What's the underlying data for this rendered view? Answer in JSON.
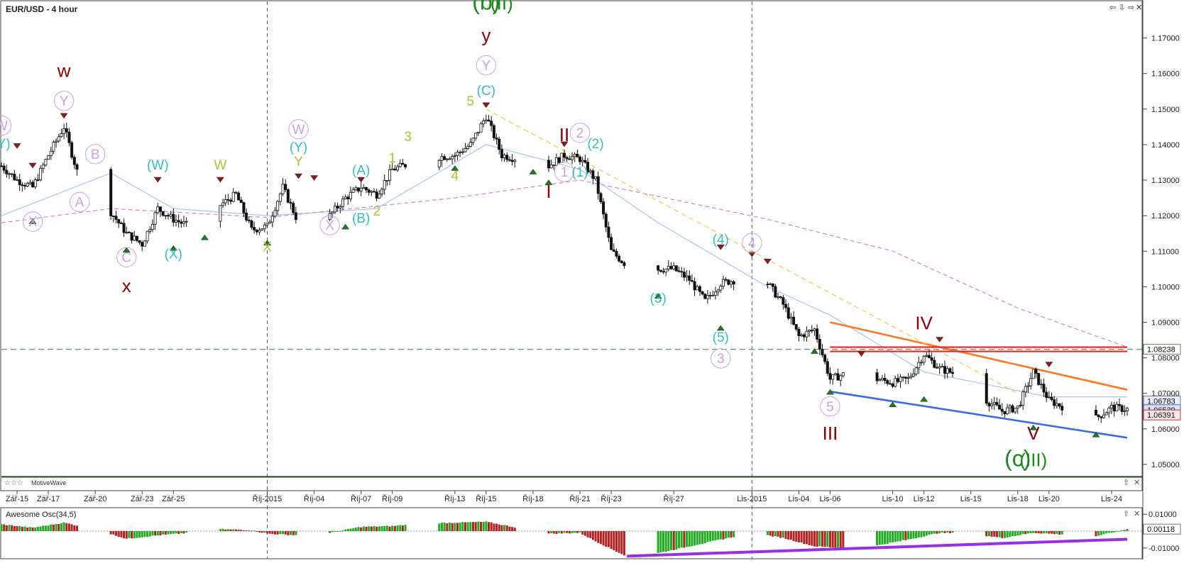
{
  "window": {
    "title": "EUR/USD - 4 hour",
    "controls": [
      "⇦",
      "⇩",
      "⇨",
      "✕"
    ]
  },
  "price_panel": {
    "y_ticks": [
      "1.17000",
      "1.16000",
      "1.15000",
      "1.14000",
      "1.13000",
      "1.12000",
      "1.11000",
      "1.10000",
      "1.09000",
      "1.08000",
      "1.07000",
      "1.06000",
      "1.05000"
    ],
    "price_badges": [
      {
        "text": "1.08238",
        "value": 1.08238
      },
      {
        "text": "1.06783",
        "value": 1.06783
      },
      {
        "text": "1.06539",
        "value": 1.06539
      },
      {
        "text": "1.06391",
        "value": 1.06391
      }
    ],
    "plugin_label": "MotiveWave",
    "x_ticks": [
      "Zář-15",
      "Zář-17",
      "Zář-20",
      "Zář-23",
      "Zář-25",
      "Říj-2015",
      "Říj-04",
      "Říj-07",
      "Říj-09",
      "Říj-13",
      "Říj-15",
      "Říj-18",
      "Říj-21",
      "Říj-23",
      "Říj-27",
      "Lis-2015",
      "Lis-04",
      "Lis-06",
      "Lis-10",
      "Lis-12",
      "Lis-15",
      "Lis-18",
      "Lis-20",
      "Lis-24"
    ]
  },
  "osc_panel": {
    "title": "Awesome Osc(34,5)",
    "y_ticks": [
      "0.01000",
      "-0.01000"
    ],
    "last_value": "0.00118",
    "controls": [
      "⇧",
      "✕"
    ]
  },
  "chart_data": [
    {
      "type": "candlestick",
      "title": "EUR/USD - 4 hour",
      "ylim": [
        1.043,
        1.1795
      ],
      "x_start": "2015-09-14",
      "x_end": "2015-11-25",
      "close_path": [
        [
          "2015-09-14",
          1.134
        ],
        [
          "2015-09-15",
          1.13
        ],
        [
          "2015-09-16",
          1.128
        ],
        [
          "2015-09-17",
          1.137
        ],
        [
          "2015-09-18",
          1.145
        ],
        [
          "2015-09-19",
          1.13
        ],
        [
          "2015-09-21",
          1.121
        ],
        [
          "2015-09-22",
          1.115
        ],
        [
          "2015-09-23",
          1.112
        ],
        [
          "2015-09-24",
          1.122
        ],
        [
          "2015-09-25",
          1.119
        ],
        [
          "2015-09-26",
          1.117
        ],
        [
          "2015-09-28",
          1.123
        ],
        [
          "2015-09-29",
          1.126
        ],
        [
          "2015-09-30",
          1.116
        ],
        [
          "2015-10-01",
          1.117
        ],
        [
          "2015-10-02",
          1.128
        ],
        [
          "2015-10-03",
          1.118
        ],
        [
          "2015-10-05",
          1.12
        ],
        [
          "2015-10-06",
          1.125
        ],
        [
          "2015-10-07",
          1.128
        ],
        [
          "2015-10-08",
          1.126
        ],
        [
          "2015-10-09",
          1.133
        ],
        [
          "2015-10-11",
          1.136
        ],
        [
          "2015-10-13",
          1.137
        ],
        [
          "2015-10-14",
          1.14
        ],
        [
          "2015-10-15",
          1.148
        ],
        [
          "2015-10-16",
          1.137
        ],
        [
          "2015-10-18",
          1.135
        ],
        [
          "2015-10-19",
          1.134
        ],
        [
          "2015-10-20",
          1.137
        ],
        [
          "2015-10-21",
          1.136
        ],
        [
          "2015-10-22",
          1.13
        ],
        [
          "2015-10-23",
          1.11
        ],
        [
          "2015-10-25",
          1.102
        ],
        [
          "2015-10-26",
          1.105
        ],
        [
          "2015-10-27",
          1.105
        ],
        [
          "2015-10-28",
          1.102
        ],
        [
          "2015-10-29",
          1.096
        ],
        [
          "2015-10-30",
          1.101
        ],
        [
          "2015-11-01",
          1.103
        ],
        [
          "2015-11-02",
          1.101
        ],
        [
          "2015-11-03",
          1.095
        ],
        [
          "2015-11-04",
          1.086
        ],
        [
          "2015-11-05",
          1.088
        ],
        [
          "2015-11-06",
          1.074
        ],
        [
          "2015-11-08",
          1.077
        ],
        [
          "2015-11-09",
          1.074
        ],
        [
          "2015-11-10",
          1.073
        ],
        [
          "2015-11-11",
          1.074
        ],
        [
          "2015-11-12",
          1.081
        ],
        [
          "2015-11-13",
          1.077
        ],
        [
          "2015-11-15",
          1.074
        ],
        [
          "2015-11-16",
          1.068
        ],
        [
          "2015-11-17",
          1.065
        ],
        [
          "2015-11-18",
          1.066
        ],
        [
          "2015-11-19",
          1.076
        ],
        [
          "2015-11-20",
          1.068
        ],
        [
          "2015-11-22",
          1.064
        ],
        [
          "2015-11-23",
          1.063
        ],
        [
          "2015-11-24",
          1.066
        ],
        [
          "2015-11-25",
          1.0655
        ]
      ],
      "horizontal_lines": [
        {
          "value": 1.08238,
          "style": "dashed",
          "color": "#5a8a5a"
        },
        {
          "value": 1.083,
          "from": "2015-11-06",
          "to": "2015-11-25",
          "color": "#ee2222"
        },
        {
          "value": 1.0818,
          "from": "2015-11-06",
          "to": "2015-11-25",
          "color": "#ee2222"
        },
        {
          "value": 1.0465,
          "style": "solid",
          "color": "#1d4f1d"
        }
      ],
      "trend_lines": [
        {
          "from": [
            "2015-11-06",
            1.09
          ],
          "to": [
            "2015-11-25",
            1.071
          ],
          "color": "#ff7722"
        },
        {
          "from": [
            "2015-11-06",
            1.0705
          ],
          "to": [
            "2015-11-25",
            1.0575
          ],
          "color": "#3a6ae8"
        },
        {
          "from": [
            "2015-10-15",
            1.15
          ],
          "to": [
            "2015-11-18",
            1.07
          ],
          "color": "#f2c84a",
          "style": "dashed"
        }
      ],
      "moving_averages": [
        {
          "color": "#aac4ee",
          "points": [
            [
              "2015-09-14",
              1.12
            ],
            [
              "2015-09-21",
              1.132
            ],
            [
              "2015-09-25",
              1.122
            ],
            [
              "2015-10-01",
              1.12
            ],
            [
              "2015-10-08",
              1.122
            ],
            [
              "2015-10-15",
              1.14
            ],
            [
              "2015-10-21",
              1.133
            ],
            [
              "2015-10-26",
              1.118
            ],
            [
              "2015-11-02",
              1.1
            ],
            [
              "2015-11-06",
              1.092
            ],
            [
              "2015-11-12",
              1.076
            ],
            [
              "2015-11-20",
              1.069
            ],
            [
              "2015-11-25",
              1.069
            ]
          ]
        },
        {
          "color": "#cc88cc",
          "style": "dashed",
          "points": [
            [
              "2015-09-14",
              1.118
            ],
            [
              "2015-09-21",
              1.122
            ],
            [
              "2015-10-01",
              1.1195
            ],
            [
              "2015-10-13",
              1.125
            ],
            [
              "2015-10-21",
              1.13
            ],
            [
              "2015-11-02",
              1.119
            ],
            [
              "2015-11-10",
              1.11
            ],
            [
              "2015-11-18",
              1.094
            ],
            [
              "2015-11-25",
              1.083
            ]
          ]
        }
      ],
      "wave_labels": [
        {
          "text": "(b)",
          "x": "2015-10-15",
          "y": 1.178,
          "color": "#1a8a1a",
          "size": "xl"
        },
        {
          "text": "(II)",
          "x": "2015-10-16",
          "y": 1.178,
          "color": "#1a8a1a",
          "size": "l"
        },
        {
          "text": "y",
          "x": "2015-10-15",
          "y": 1.169,
          "color": "#8b0000",
          "size": "l"
        },
        {
          "text": "Y",
          "x": "2015-10-15",
          "y": 1.161,
          "color": "#c8a0e8",
          "size": "m",
          "circle": true
        },
        {
          "text": "(C)",
          "x": "2015-10-15",
          "y": 1.154,
          "color": "#30c0c0",
          "size": "m"
        },
        {
          "text": "5",
          "x": "2015-10-14",
          "y": 1.151,
          "color": "#a8c830",
          "size": "m"
        },
        {
          "text": "w",
          "x": "2015-09-18",
          "y": 1.159,
          "color": "#8b0000",
          "size": "l"
        },
        {
          "text": "Y",
          "x": "2015-09-18",
          "y": 1.151,
          "color": "#c8a0e8",
          "size": "m",
          "circle": true
        },
        {
          "text": "W",
          "x": "2015-09-14",
          "y": 1.144,
          "color": "#c8a0e8",
          "size": "m",
          "circle": true
        },
        {
          "text": "(Y)",
          "x": "2015-09-14",
          "y": 1.139,
          "color": "#30c0c0",
          "size": "m"
        },
        {
          "text": "B",
          "x": "2015-09-20",
          "y": 1.136,
          "color": "#c8a0e8",
          "size": "m",
          "circle": true
        },
        {
          "text": "A",
          "x": "2015-09-19",
          "y": 1.1225,
          "color": "#c8a0e8",
          "size": "m",
          "circle": true
        },
        {
          "text": "X",
          "x": "2015-09-16",
          "y": 1.117,
          "color": "#c8a0e8",
          "size": "m",
          "circle": true
        },
        {
          "text": "C",
          "x": "2015-09-22",
          "y": 1.107,
          "color": "#c8a0e8",
          "size": "m",
          "circle": true
        },
        {
          "text": "x",
          "x": "2015-09-22",
          "y": 1.0985,
          "color": "#8b0000",
          "size": "l"
        },
        {
          "text": "(W)",
          "x": "2015-09-24",
          "y": 1.133,
          "color": "#30c0c0",
          "size": "m"
        },
        {
          "text": "(X)",
          "x": "2015-09-25",
          "y": 1.108,
          "color": "#30c0c0",
          "size": "m"
        },
        {
          "text": "W",
          "x": "2015-09-28",
          "y": 1.133,
          "color": "#a8c830",
          "size": "m"
        },
        {
          "text": "W",
          "x": "2015-10-03",
          "y": 1.143,
          "color": "#c8a0e8",
          "size": "m",
          "circle": true
        },
        {
          "text": "(Y)",
          "x": "2015-10-03",
          "y": 1.138,
          "color": "#30c0c0",
          "size": "m"
        },
        {
          "text": "Y",
          "x": "2015-10-03",
          "y": 1.134,
          "color": "#a8c830",
          "size": "m"
        },
        {
          "text": "X",
          "x": "2015-10-01",
          "y": 1.11,
          "color": "#a8c830",
          "size": "m"
        },
        {
          "text": "X",
          "x": "2015-10-05",
          "y": 1.116,
          "color": "#c8a0e8",
          "size": "m",
          "circle": true
        },
        {
          "text": "(A)",
          "x": "2015-10-07",
          "y": 1.1315,
          "color": "#30c0c0",
          "size": "m"
        },
        {
          "text": "(B)",
          "x": "2015-10-07",
          "y": 1.118,
          "color": "#30c0c0",
          "size": "m"
        },
        {
          "text": "1",
          "x": "2015-10-09",
          "y": 1.135,
          "color": "#a8c830",
          "size": "m"
        },
        {
          "text": "2",
          "x": "2015-10-08",
          "y": 1.12,
          "color": "#a8c830",
          "size": "m"
        },
        {
          "text": "3",
          "x": "2015-10-10",
          "y": 1.141,
          "color": "#a8c830",
          "size": "m"
        },
        {
          "text": "4",
          "x": "2015-10-13",
          "y": 1.13,
          "color": "#a8c830",
          "size": "m"
        },
        {
          "text": "II",
          "x": "2015-10-20",
          "y": 1.141,
          "color": "#8b0000",
          "size": "l"
        },
        {
          "text": "I",
          "x": "2015-10-19",
          "y": 1.125,
          "color": "#8b0000",
          "size": "l"
        },
        {
          "text": "2",
          "x": "2015-10-21",
          "y": 1.142,
          "color": "#c8a0e8",
          "size": "m",
          "circle": true
        },
        {
          "text": "(2)",
          "x": "2015-10-22",
          "y": 1.139,
          "color": "#30c0c0",
          "size": "m"
        },
        {
          "text": "1",
          "x": "2015-10-20",
          "y": 1.131,
          "color": "#c8a0e8",
          "size": "m",
          "circle": true
        },
        {
          "text": "(1)",
          "x": "2015-10-21",
          "y": 1.131,
          "color": "#30c0c0",
          "size": "m"
        },
        {
          "text": "(3)",
          "x": "2015-10-26",
          "y": 1.0955,
          "color": "#30c0c0",
          "size": "m"
        },
        {
          "text": "(4)",
          "x": "2015-10-30",
          "y": 1.112,
          "color": "#30c0c0",
          "size": "m"
        },
        {
          "text": "4",
          "x": "2015-11-01",
          "y": 1.111,
          "color": "#c8a0e8",
          "size": "m",
          "circle": true
        },
        {
          "text": "(5)",
          "x": "2015-10-30",
          "y": 1.0845,
          "color": "#30c0c0",
          "size": "m"
        },
        {
          "text": "3",
          "x": "2015-10-30",
          "y": 1.0785,
          "color": "#c8a0e8",
          "size": "m",
          "circle": true
        },
        {
          "text": "5",
          "x": "2015-11-06",
          "y": 1.065,
          "color": "#c8a0e8",
          "size": "m",
          "circle": true
        },
        {
          "text": "III",
          "x": "2015-11-06",
          "y": 1.057,
          "color": "#8b0000",
          "size": "l"
        },
        {
          "text": "IV",
          "x": "2015-11-12",
          "y": 1.088,
          "color": "#8b0000",
          "size": "l"
        },
        {
          "text": "V",
          "x": "2015-11-19",
          "y": 1.057,
          "color": "#8b0000",
          "size": "l"
        },
        {
          "text": "(c)",
          "x": "2015-11-18",
          "y": 1.0495,
          "color": "#1a8a1a",
          "size": "xl"
        },
        {
          "text": "(III)",
          "x": "2015-11-19",
          "y": 1.0495,
          "color": "#1a8a1a",
          "size": "l"
        }
      ]
    },
    {
      "type": "bar",
      "title": "Awesome Osc(34,5)",
      "ylim": [
        -0.0155,
        0.013
      ],
      "last_value": 0.00118,
      "profile": [
        [
          "2015-09-14",
          0.004
        ],
        [
          "2015-09-16",
          0.002
        ],
        [
          "2015-09-18",
          0.005
        ],
        [
          "2015-09-20",
          0.001
        ],
        [
          "2015-09-22",
          -0.0045
        ],
        [
          "2015-09-24",
          -0.0025
        ],
        [
          "2015-09-26",
          -0.001
        ],
        [
          "2015-09-28",
          0.0012
        ],
        [
          "2015-09-30",
          0.0005
        ],
        [
          "2015-10-01",
          -0.0015
        ],
        [
          "2015-10-03",
          -0.0025
        ],
        [
          "2015-10-05",
          -0.001
        ],
        [
          "2015-10-07",
          0.0025
        ],
        [
          "2015-10-09",
          0.003
        ],
        [
          "2015-10-11",
          0.0045
        ],
        [
          "2015-10-13",
          0.005
        ],
        [
          "2015-10-15",
          0.0055
        ],
        [
          "2015-10-17",
          0.002
        ],
        [
          "2015-10-19",
          -0.0015
        ],
        [
          "2015-10-21",
          -0.001
        ],
        [
          "2015-10-22",
          -0.006
        ],
        [
          "2015-10-24",
          -0.015
        ],
        [
          "2015-10-26",
          -0.013
        ],
        [
          "2015-10-28",
          -0.009
        ],
        [
          "2015-10-30",
          -0.005
        ],
        [
          "2015-11-01",
          -0.001
        ],
        [
          "2015-11-03",
          -0.004
        ],
        [
          "2015-11-05",
          -0.009
        ],
        [
          "2015-11-07",
          -0.01
        ],
        [
          "2015-11-09",
          -0.0085
        ],
        [
          "2015-11-11",
          -0.005
        ],
        [
          "2015-11-13",
          -0.001
        ],
        [
          "2015-11-15",
          -0.0015
        ],
        [
          "2015-11-17",
          -0.004
        ],
        [
          "2015-11-19",
          -0.001
        ],
        [
          "2015-11-21",
          -0.002
        ],
        [
          "2015-11-23",
          -0.003
        ],
        [
          "2015-11-25",
          0.0012
        ]
      ],
      "trend_line": {
        "from": [
          "2015-10-24",
          -0.0148
        ],
        "to": [
          "2015-11-25",
          -0.0048
        ],
        "color": "#9a2ee8"
      }
    }
  ]
}
